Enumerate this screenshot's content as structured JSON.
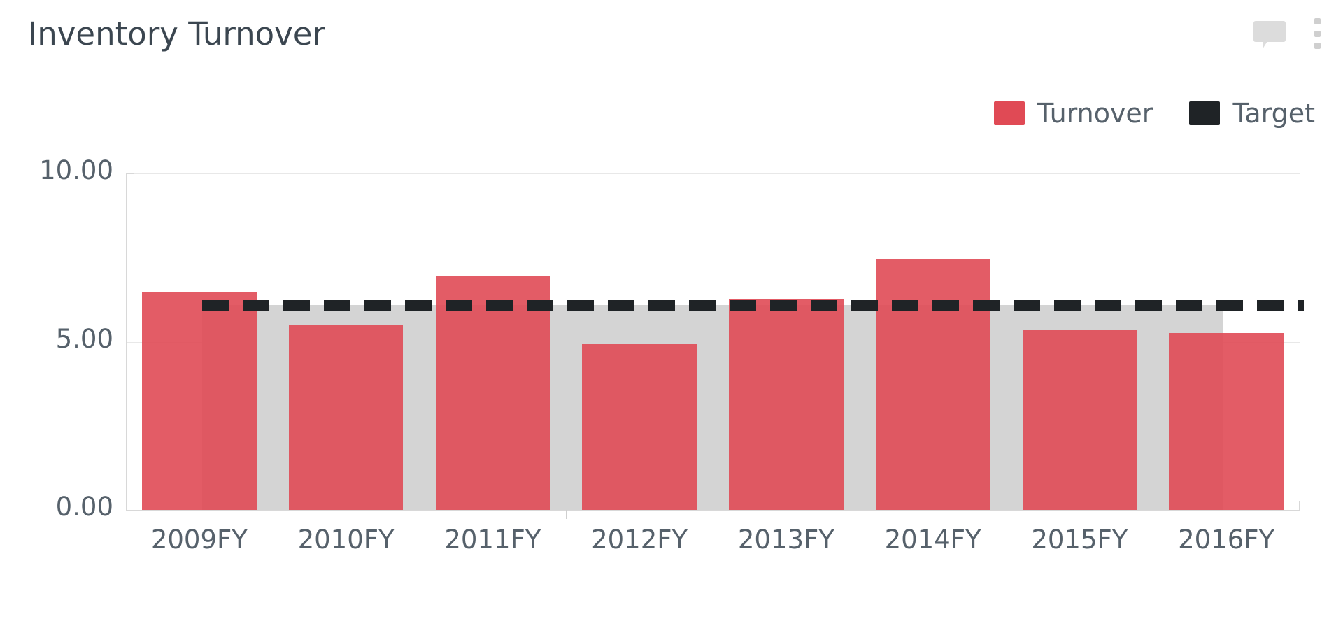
{
  "card": {
    "title": "Inventory Turnover"
  },
  "header_actions": [
    {
      "name": "comment-icon",
      "label": "comment-icon"
    },
    {
      "name": "more-options-icon",
      "label": "kebab-menu-icon"
    }
  ],
  "colors": {
    "turnover": "#e04a55",
    "turnover_overlap": "#bc4049",
    "target": "#1f2326",
    "reference_band": "#d4d4d4",
    "axis_text": "#56616b",
    "title_text": "#3b4650",
    "gridline": "#e8e8e8",
    "background": "#ffffff"
  },
  "chart_data": {
    "type": "bar",
    "title": "Inventory Turnover",
    "xlabel": "",
    "ylabel": "",
    "ylim": [
      0,
      10
    ],
    "yticks": [
      "0.00",
      "5.00",
      "10.00"
    ],
    "ytick_values": [
      0,
      5,
      10
    ],
    "grid": true,
    "legend_position": "top-right",
    "categories": [
      "2009FY",
      "2010FY",
      "2011FY",
      "2012FY",
      "2013FY",
      "2014FY",
      "2015FY",
      "2016FY"
    ],
    "series": [
      {
        "name": "Turnover",
        "type": "bar",
        "color": "#e04a55",
        "values": [
          6.46,
          5.48,
          6.94,
          4.92,
          6.27,
          7.46,
          5.35,
          5.25
        ]
      },
      {
        "name": "Target",
        "type": "reference-line",
        "style": "dashed",
        "color": "#1f2326",
        "value": 6.1,
        "values": [
          6.1,
          6.1,
          6.1,
          6.1,
          6.1,
          6.1,
          6.1,
          6.1
        ]
      }
    ],
    "reference_band": {
      "name": "Target band",
      "color": "#d4d4d4",
      "top_value": 6.1,
      "bottom_value": 0
    }
  },
  "legend": [
    {
      "label": "Turnover",
      "color": "#e04a55"
    },
    {
      "label": "Target",
      "color": "#1f2326"
    }
  ]
}
